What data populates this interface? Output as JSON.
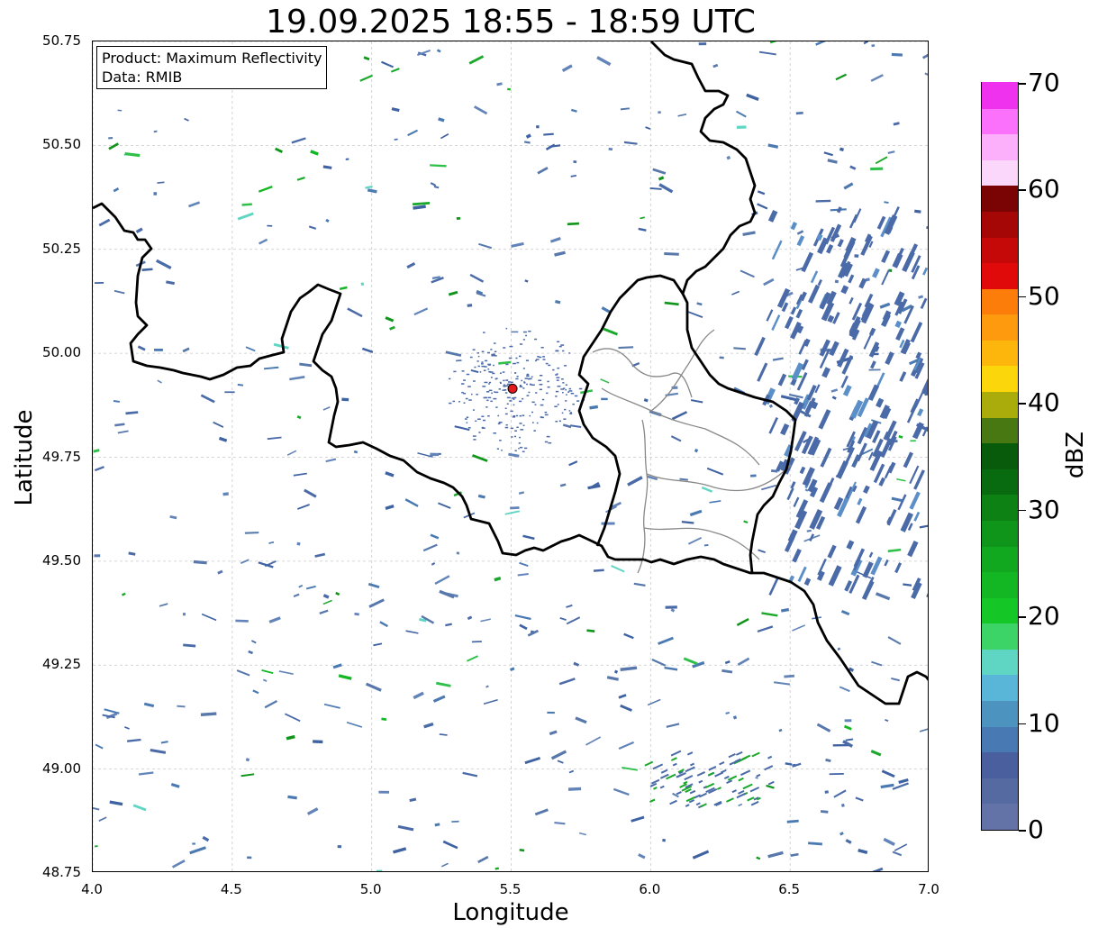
{
  "title": "19.09.2025 18:55 - 18:59 UTC",
  "legend": {
    "product": "Product: Maximum Reflectivity",
    "data": "Data: RMIB"
  },
  "axes": {
    "xlabel": "Longitude",
    "ylabel": "Latitude",
    "xlim": [
      4.0,
      7.0
    ],
    "ylim": [
      48.75,
      50.75
    ],
    "xticks": [
      "4.0",
      "4.5",
      "5.0",
      "5.5",
      "6.0",
      "6.5",
      "7.0"
    ],
    "yticks": [
      "50.75",
      "50.50",
      "50.25",
      "50.00",
      "49.75",
      "49.50",
      "49.25",
      "49.00",
      "48.75"
    ],
    "grid": true
  },
  "radar_site": {
    "lon": 5.505,
    "lat": 49.915,
    "color": "#e31a1c"
  },
  "colorbar": {
    "label": "dBZ",
    "range": [
      0,
      70
    ],
    "ticks": [
      "0",
      "10",
      "20",
      "30",
      "40",
      "50",
      "60",
      "70"
    ],
    "colors": [
      "#6373a7",
      "#546aa1",
      "#4a609e",
      "#4979b2",
      "#4c93c0",
      "#5ab6d8",
      "#5fd6c3",
      "#3dd467",
      "#14c727",
      "#12b723",
      "#11a81f",
      "#0f9519",
      "#0d8114",
      "#096b10",
      "#075b0a",
      "#477811",
      "#aaac0c",
      "#fbd60a",
      "#fdb60c",
      "#fe9a0d",
      "#fd7d0a",
      "#e10a0a",
      "#c50808",
      "#a50606",
      "#7a0303",
      "#fcd7fc",
      "#fcb0fb",
      "#fc71fb",
      "#ee32ee"
    ]
  },
  "colors": {
    "grid": "#c8c8c8",
    "border": "#000000",
    "province": "#888888",
    "echo_light": "#4a6aa8",
    "echo_green": "#1aa82a"
  }
}
